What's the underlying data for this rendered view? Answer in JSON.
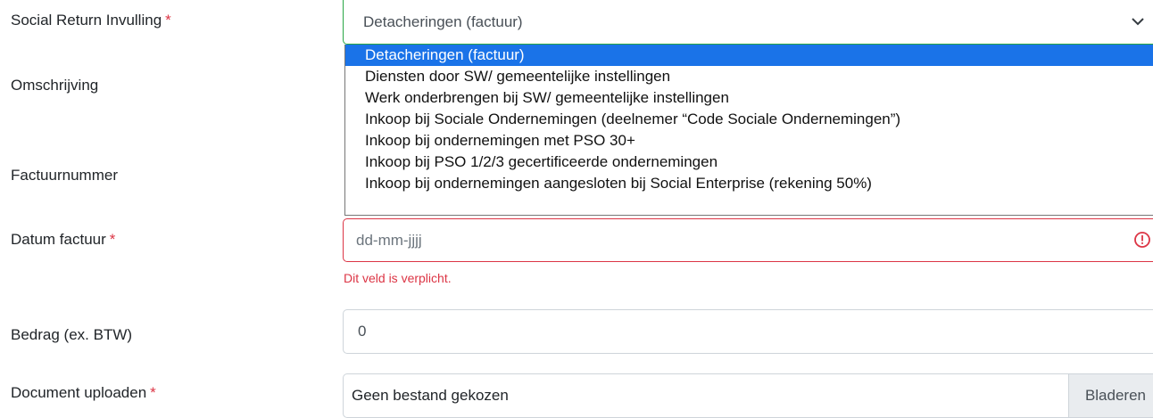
{
  "form": {
    "social_return": {
      "label": "Social Return Invulling",
      "required_mark": "*",
      "selected": "Detacheringen (factuur)",
      "options": [
        "Detacheringen (factuur)",
        "Diensten door SW/ gemeentelijke instellingen",
        "Werk onderbrengen bij SW/ gemeentelijke instellingen",
        "Inkoop bij Sociale Ondernemingen (deelnemer “Code Sociale Ondernemingen”)",
        "Inkoop bij ondernemingen met PSO 30+",
        "Inkoop bij PSO 1/2/3 gecertificeerde ondernemingen",
        "Inkoop bij ondernemingen aangesloten bij Social Enterprise (rekening 50%)"
      ]
    },
    "omschrijving": {
      "label": "Omschrijving"
    },
    "factuurnummer": {
      "label": "Factuurnummer"
    },
    "datum_factuur": {
      "label": "Datum factuur",
      "required_mark": "*",
      "placeholder": "dd-mm-jjjj",
      "error": "Dit veld is verplicht."
    },
    "bedrag": {
      "label": "Bedrag (ex. BTW)",
      "value": "0"
    },
    "document": {
      "label": "Document uploaden",
      "required_mark": "*",
      "file_text": "Geen bestand gekozen",
      "browse_label": "Bladeren"
    }
  },
  "colors": {
    "error": "#dc3545",
    "valid": "#28a745",
    "selected_option": "#1a73e8"
  },
  "icons": {
    "select_arrow": "chevron-down-icon",
    "error": "warning-circle-icon"
  }
}
